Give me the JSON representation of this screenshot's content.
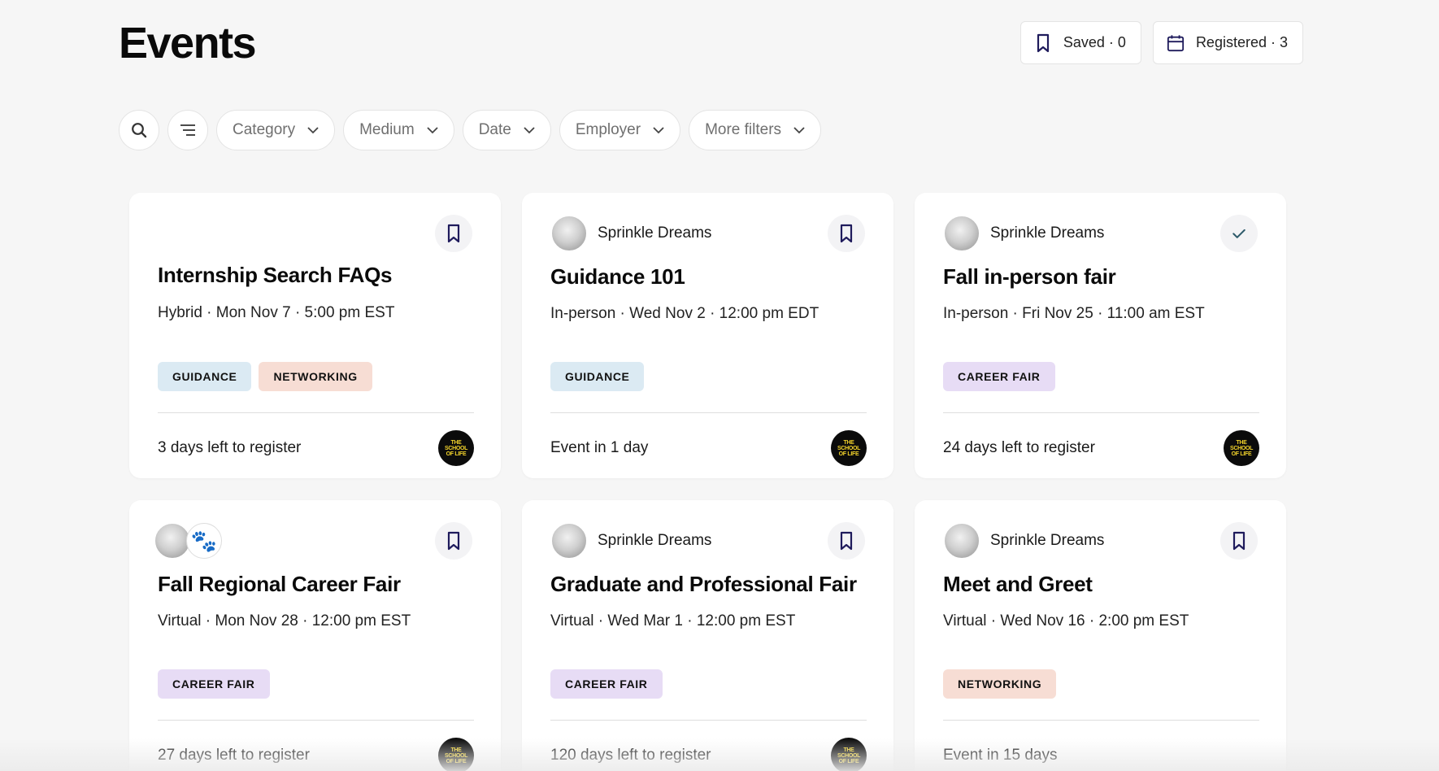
{
  "page": {
    "title": "Events"
  },
  "header": {
    "saved_label": "Saved · 0",
    "registered_label": "Registered · 3"
  },
  "filters": {
    "items": [
      {
        "label": "Category"
      },
      {
        "label": "Medium"
      },
      {
        "label": "Date"
      },
      {
        "label": "Employer"
      },
      {
        "label": "More filters"
      }
    ]
  },
  "cards": [
    {
      "org": "",
      "title": "Internship Search FAQs",
      "meta": "Hybrid · Mon Nov 7 · 5:00 pm EST",
      "tags": [
        "GUIDANCE",
        "NETWORKING"
      ],
      "footer": "3 days left to register",
      "action_icon": "bookmark-icon"
    },
    {
      "org": "Sprinkle Dreams",
      "title": "Guidance 101",
      "meta": "In-person · Wed Nov 2 · 12:00 pm EDT",
      "tags": [
        "GUIDANCE"
      ],
      "footer": "Event in 1 day",
      "action_icon": "bookmark-icon"
    },
    {
      "org": "Sprinkle Dreams",
      "title": "Fall in-person fair",
      "meta": "In-person · Fri Nov 25 · 11:00 am EST",
      "tags": [
        "CAREER FAIR"
      ],
      "footer": "24 days left to register",
      "action_icon": "checkmark-icon"
    },
    {
      "org": "",
      "title": "Fall Regional Career Fair",
      "meta": "Virtual · Mon Nov 28 · 12:00 pm EST",
      "tags": [
        "CAREER FAIR"
      ],
      "footer": "27 days left to register",
      "action_icon": "bookmark-icon"
    },
    {
      "org": "Sprinkle Dreams",
      "title": "Graduate and Professional Fair",
      "meta": "Virtual · Wed Mar 1 · 12:00 pm EST",
      "tags": [
        "CAREER FAIR"
      ],
      "footer": "120 days left to register",
      "action_icon": "bookmark-icon"
    },
    {
      "org": "Sprinkle Dreams",
      "title": "Meet and Greet",
      "meta": "Virtual · Wed Nov 16 · 2:00 pm EST",
      "tags": [
        "NETWORKING"
      ],
      "footer": "Event in 15 days",
      "action_icon": "bookmark-icon"
    }
  ],
  "logo_text": "THE SCHOOL OF LIFE",
  "colors": {
    "accent": "#1f1b5c",
    "check": "#2d5a6a",
    "tag_guidance": "#dbeaf3",
    "tag_networking": "#f7ddd4",
    "tag_career_fair": "#e7dcf5"
  }
}
